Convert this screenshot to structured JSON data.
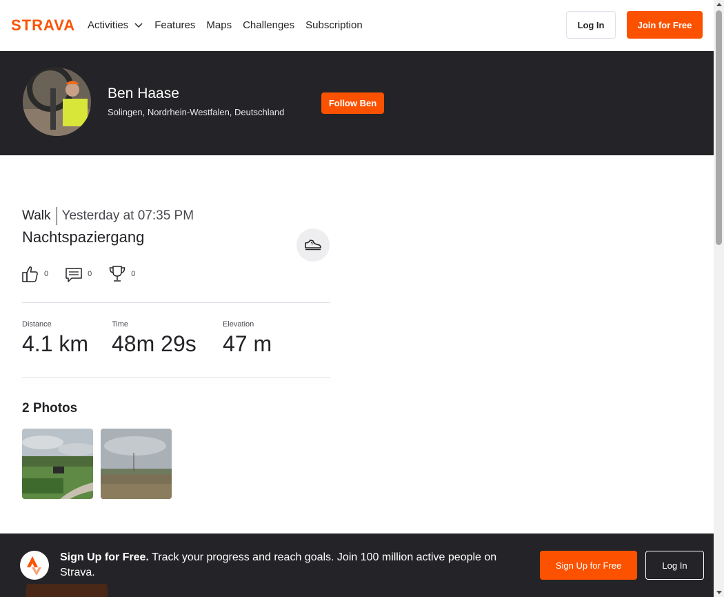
{
  "nav": {
    "logo_text": "STRAVA",
    "items": [
      {
        "label": "Activities"
      },
      {
        "label": "Features"
      },
      {
        "label": "Maps"
      },
      {
        "label": "Challenges"
      },
      {
        "label": "Subscription"
      }
    ],
    "login_label": "Log In",
    "join_label": "Join for Free"
  },
  "athlete": {
    "name": "Ben Haase",
    "location": "Solingen, Nordrhein-Westfalen, Deutschland",
    "follow_label": "Follow Ben"
  },
  "activity": {
    "type": "Walk",
    "time": "Yesterday at 07:35 PM",
    "title": "Nachtspaziergang",
    "sport_icon": "shoe-icon",
    "kudos_count": "0",
    "comments_count": "0",
    "achievements_count": "0",
    "stats": [
      {
        "label": "Distance",
        "value": "4.1 km"
      },
      {
        "label": "Time",
        "value": "48m 29s"
      },
      {
        "label": "Elevation",
        "value": "47 m"
      }
    ],
    "photos_title": "2 Photos"
  },
  "banner": {
    "strong_text": "Sign Up for Free.",
    "text": " Track your progress and reach goals. Join 100 million active people on Strava.",
    "signup_label": "Sign Up for Free",
    "login_label": "Log In"
  },
  "colors": {
    "brand": "#fc5200",
    "dark": "#242428"
  }
}
